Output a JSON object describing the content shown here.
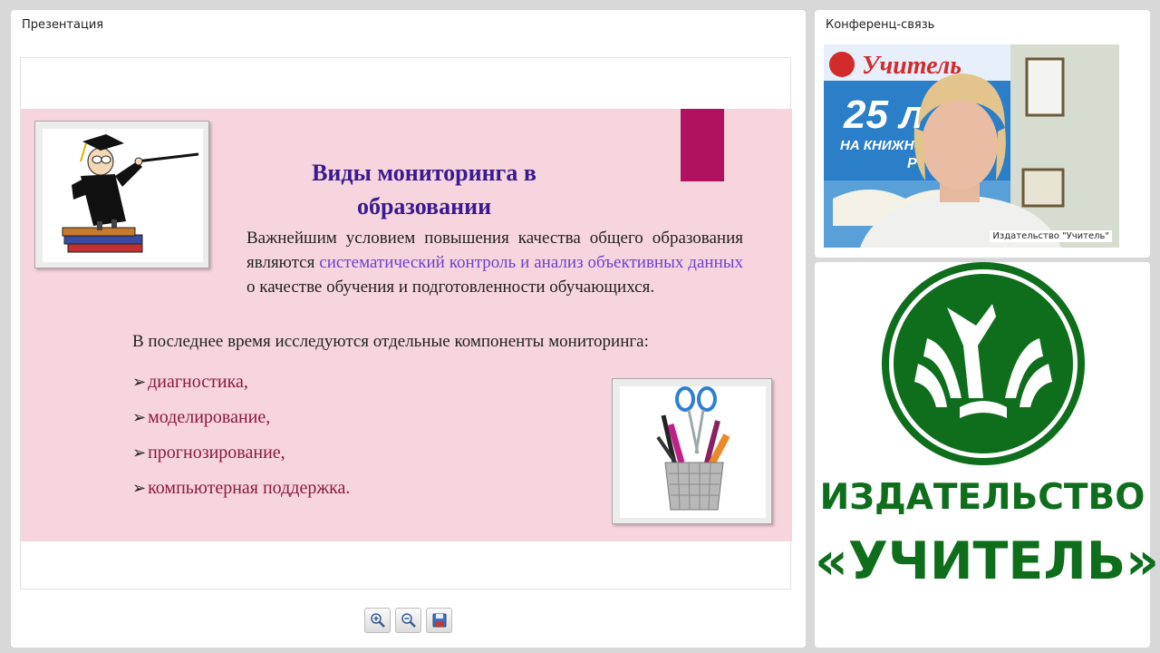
{
  "presentation": {
    "title": "Презентация",
    "slide": {
      "title": "Виды мониторинга в образовании",
      "paragraph": {
        "part1": "Важнейшим условием повышения качества общего образования являются",
        "highlight": "систематический контроль и анализ объективных данных",
        "part2": "о качестве обучения и подготовленности обучающихся."
      },
      "lead": "В последнее время исследуются отдельные компоненты мониторинга:",
      "bullets": [
        "диагностика,",
        "моделирование,",
        "прогнозирование,",
        "компьютерная поддержка."
      ],
      "colors": {
        "band": "#f7d5de",
        "accent": "#b0125f",
        "title": "#3a1a8e",
        "highlight": "#6d3fd0",
        "bullets": "#8a1a3c"
      }
    },
    "toolbar": {
      "buttons": [
        {
          "icon": "zoom-in-icon"
        },
        {
          "icon": "zoom-out-icon"
        },
        {
          "icon": "save-icon"
        }
      ]
    }
  },
  "conference": {
    "title": "Конференц-связь",
    "video": {
      "caption": "Издательство \"Учитель\"",
      "poster_brand": "Учитель",
      "poster_big": "25 л",
      "poster_sub": "НА КНИЖНО",
      "poster_tail": "Р"
    }
  },
  "logo": {
    "line1": "ИЗДАТЕЛЬСТВО",
    "line2": "«УЧИТЕЛЬ»",
    "color": "#0e6e1c"
  }
}
